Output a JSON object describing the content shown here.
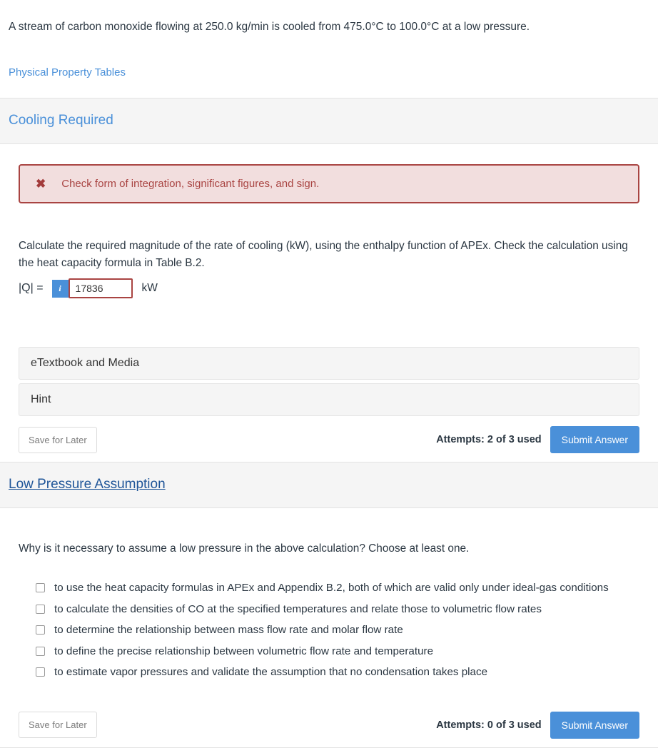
{
  "problem": {
    "statement": "A stream of carbon monoxide flowing at 250.0 kg/min is cooled from 475.0°C to 100.0°C at a low pressure.",
    "resource_link": "Physical Property Tables"
  },
  "sections": [
    {
      "title": "Cooling Required",
      "linked": false,
      "alert": {
        "icon": "error-x-icon",
        "glyph": "✖",
        "message": "Check form of integration, significant figures, and sign."
      },
      "prompt": "Calculate the required magnitude of the rate of cooling (kW), using the enthalpy function of APEx. Check the calculation using the heat capacity formula in Table B.2.",
      "answer": {
        "label": "|Q| =",
        "info_badge": "i",
        "value": "17836",
        "placeholder": "",
        "unit": "kW"
      },
      "panels": [
        {
          "label": "eTextbook and Media"
        },
        {
          "label": "Hint"
        }
      ],
      "footer": {
        "save_label": "Save for Later",
        "attempts": "Attempts: 2 of 3 used",
        "submit_label": "Submit Answer"
      }
    },
    {
      "title": "Low Pressure Assumption",
      "linked": true,
      "prompt": "Why is it necessary to assume a low pressure in the above calculation? Choose at least one.",
      "choices": [
        {
          "label": "to use the heat capacity formulas in APEx and Appendix B.2, both of which are valid only under ideal-gas conditions",
          "checked": false
        },
        {
          "label": "to calculate the densities of CO at the specified temperatures and relate those to volumetric flow rates",
          "checked": false
        },
        {
          "label": "to determine the relationship between mass flow rate and molar flow rate",
          "checked": false
        },
        {
          "label": "to define the precise relationship between volumetric flow rate and temperature",
          "checked": false
        },
        {
          "label": "to estimate vapor pressures and validate the assumption that no condensation takes place",
          "checked": false
        }
      ],
      "footer": {
        "save_label": "Save for Later",
        "attempts": "Attempts: 0 of 3 used",
        "submit_label": "Submit Answer"
      }
    }
  ],
  "colors": {
    "accent_blue": "#4a90d9",
    "link_dark_blue": "#1f5598",
    "error_red": "#a94442",
    "error_bg": "#f2dede",
    "panel_bg": "#f5f5f5",
    "border_gray": "#e3e3e3"
  }
}
